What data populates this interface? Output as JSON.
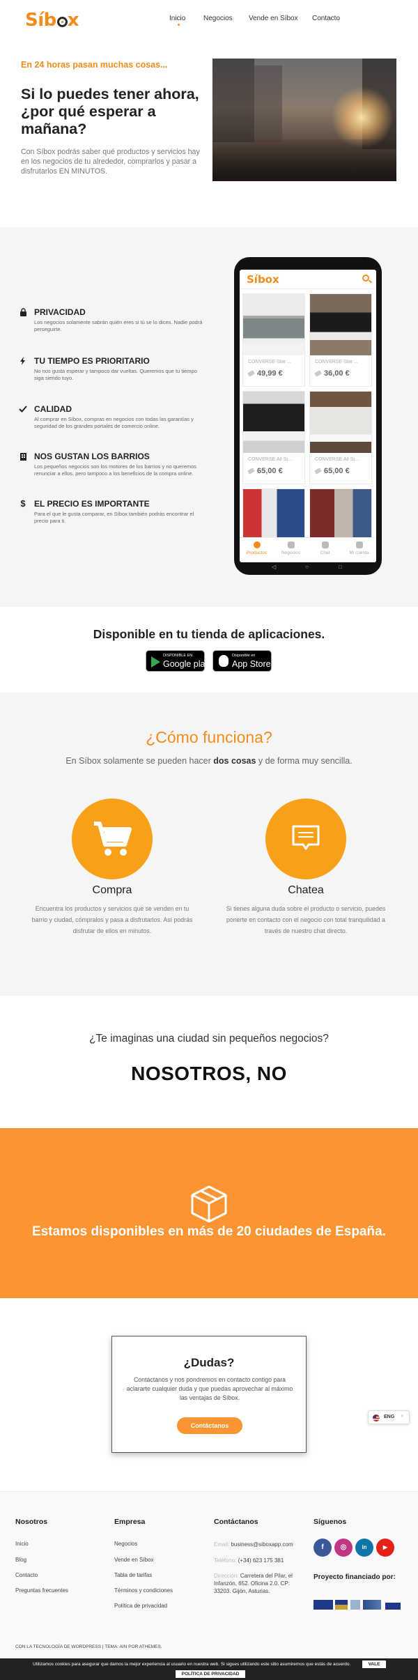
{
  "brand": {
    "logo_text_a": "Síb",
    "logo_text_b": "x",
    "accent": "#f28c1a"
  },
  "nav": {
    "items": [
      "Inicio",
      "Negocios",
      "Vende en Síbox",
      "Contacto"
    ],
    "active": "Inicio"
  },
  "hero": {
    "kicker": "En 24 horas pasan muchas cosas...",
    "title": "Si lo puedes tener ahora, ¿por qué esperar a mañana?",
    "text": "Con Síbox podrás saber qué productos y servicios hay en los negocios de tu alrededor, comprarlos y pasar a disfrutarlos EN MINUTOS."
  },
  "features": [
    {
      "icon": "lock-icon",
      "title": "PRIVACIDAD",
      "desc": "Los negocios solamente sabrán quién eres si tú se lo dices. Nadie podrá perseguirte."
    },
    {
      "icon": "bolt-icon",
      "title": "TU TIEMPO ES PRIORITARIO",
      "desc": "No nos gusta esperar y tampoco dar vueltas. Queremos que tu tiempo siga siendo tuyo."
    },
    {
      "icon": "check-icon",
      "title": "CALIDAD",
      "desc": "Al comprar en Síbox, compras en negocios con todas las garantías y seguridad de los grandes portales de comercio online."
    },
    {
      "icon": "store-icon",
      "title": "NOS GUSTAN LOS BARRIOS",
      "desc": "Los pequeños negocios son los motores de los barrios y no queremos renunciar a ellos, pero tampoco a los beneficios de la compra online."
    },
    {
      "icon": "dollar-icon",
      "title": "EL PRECIO ES IMPORTANTE",
      "desc": "Para el que le gusta comparar, en Síbox también podrás encontrar el precio para ti."
    }
  ],
  "phone": {
    "app_logo": "Síbox",
    "cards": [
      {
        "name": "CONVERSE Star ...",
        "price": "49,99 €"
      },
      {
        "name": "CONVERSE Star ...",
        "price": "36,00 €"
      },
      {
        "name": "CONVERSE All St...",
        "price": "65,00 €"
      },
      {
        "name": "CONVERSE All St...",
        "price": "65,00 €"
      }
    ],
    "tabs": [
      "Productos",
      "Negocios",
      "Chat",
      "Mi cuenta"
    ],
    "sysnav": [
      "◁",
      "○",
      "□"
    ]
  },
  "store": {
    "title": "Disponible en tu tienda de aplicaciones.",
    "google_small": "DISPONIBLE EN",
    "google_large": "Google play",
    "apple_small": "Disponible en",
    "apple_large": "App Store"
  },
  "how": {
    "title": "¿Cómo funciona?",
    "sub_a": "En Síbox solamente se pueden hacer ",
    "sub_b": "dos cosas",
    "sub_c": " y de forma muy sencilla.",
    "steps": [
      {
        "icon": "cart-icon",
        "title": "Compra",
        "text": "Encuentra los productos y servicios que se venden en tu barrio y ciudad, cómpralos y pasa a disfrutarlos. Así podrás disfrutar de ellos en minutos."
      },
      {
        "icon": "chat-icon",
        "title": "Chatea",
        "text": "Si tienes alguna duda sobre el producto o servicio, puedes ponerte en contacto con el negocio con total tranquilidad a través de nuestro chat directo."
      }
    ]
  },
  "nosotros": {
    "question": "¿Te imaginas una ciudad sin pequeños negocios?",
    "answer": "NOSOTROS, NO"
  },
  "cities": {
    "text": "Estamos disponibles en más de 20 ciudades de España."
  },
  "dudas": {
    "title": "¿Dudas?",
    "text": "Contáctanos y nos pondremos en contacto contigo para aclararte cualquier duda y que puedas aprovechar al máximo las ventajas de Síbox.",
    "button": "Contáctanos"
  },
  "lang": {
    "code": "ENG"
  },
  "footer": {
    "col1": {
      "title": "Nosotros",
      "links": [
        "Inicio",
        "Blog",
        "Contacto",
        "Preguntas frecuentes"
      ]
    },
    "col2": {
      "title": "Empresa",
      "links": [
        "Negocios",
        "Vende en Síbox",
        "Tabla de tarifas",
        "Términos y condiciones",
        "Política de privacidad"
      ]
    },
    "col3": {
      "title": "Contáctanos",
      "email_label": "Email:",
      "email": "business@siboxapp.com",
      "phone_label": "Teléfono:",
      "phone": "(+34) 623 175 381",
      "addr_label": "Dirección:",
      "addr": "Carretera del Pilar, el Infanzón, 652. Oficina 2.0. CP: 33203. Gijón, Asturias."
    },
    "col4": {
      "title": "Síguenos",
      "social": [
        "f",
        "◎",
        "in",
        "▶"
      ],
      "project": "Proyecto financiado por:"
    },
    "credit": "CON LA TECNOLOGÍA DE WORDPRESS | TEMA: AIN POR ATHEMES."
  },
  "cookie": {
    "text": "Utilizamos cookies para asegurar que damos la mejor experiencia al usuario en nuestra web. Si sigues utilizando este sitio asumiremos que estás de acuerdo.",
    "accept": "VALE",
    "policy": "POLÍTICA DE PRIVACIDAD"
  }
}
